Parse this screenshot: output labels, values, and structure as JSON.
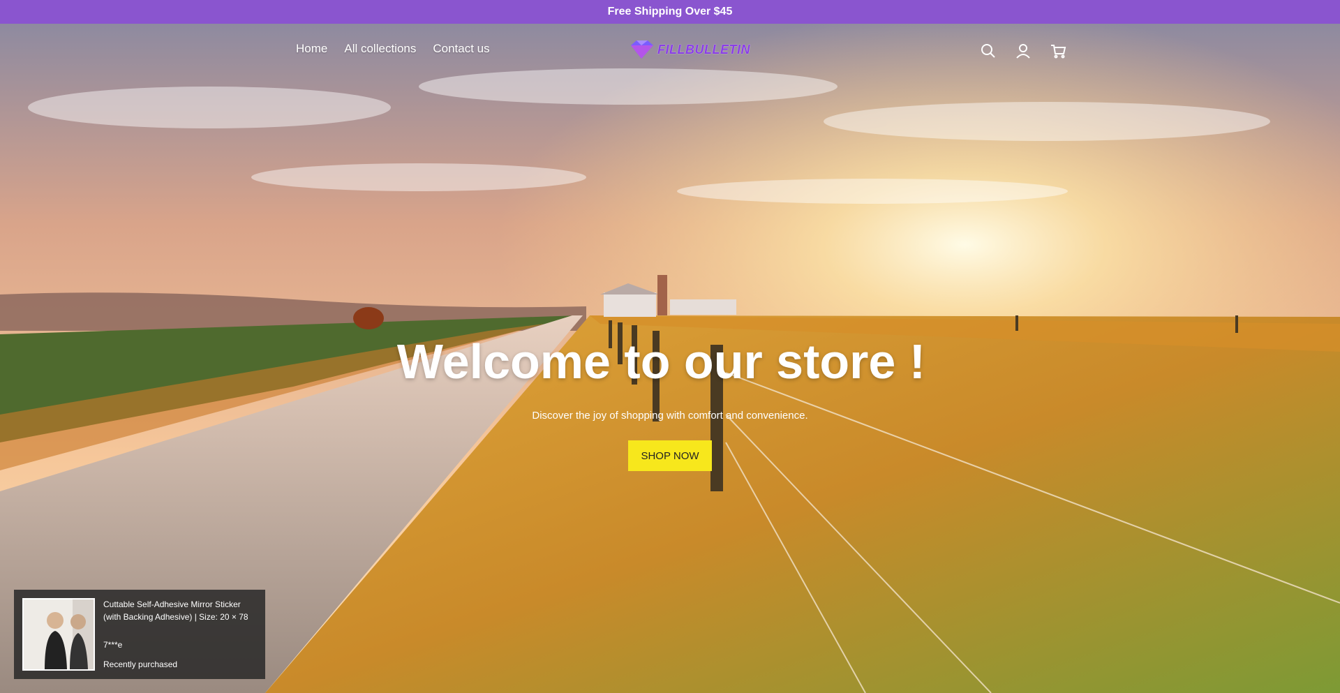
{
  "announcement": {
    "text": "Free Shipping Over $45"
  },
  "header": {
    "nav": [
      {
        "label": "Home"
      },
      {
        "label": "All collections"
      },
      {
        "label": "Contact us"
      }
    ],
    "logo_text": "FILLBULLETIN",
    "icons": [
      "search-icon",
      "account-icon",
      "cart-icon"
    ]
  },
  "hero": {
    "title": "Welcome to our store !",
    "subtitle": "Discover the joy of shopping with comfort and convenience.",
    "button_label": "SHOP NOW"
  },
  "recent_purchase": {
    "product": "Cuttable Self-Adhesive Mirror Sticker (with Backing Adhesive) | Size: 20 × 78",
    "user": "7***e",
    "status": "Recently purchased"
  },
  "colors": {
    "announcement_bg": "#8a55cf",
    "button_bg": "#f7e71c",
    "logo": "#8a3ee6"
  }
}
